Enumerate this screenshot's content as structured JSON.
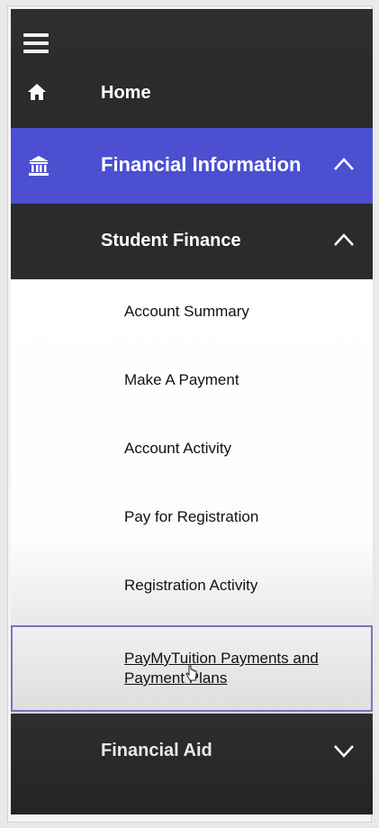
{
  "nav": {
    "home_label": "Home",
    "financial_information_label": "Financial Information",
    "student_finance_label": "Student Finance",
    "student_finance_items": [
      {
        "label": "Account Summary"
      },
      {
        "label": "Make A Payment"
      },
      {
        "label": "Account Activity"
      },
      {
        "label": "Pay for Registration"
      },
      {
        "label": "Registration Activity"
      }
    ],
    "active_item_label": "PayMyTuition Payments and Payment Plans",
    "financial_aid_label": "Financial Aid"
  },
  "colors": {
    "accent": "#4b4fd0",
    "dark": "#2b2b2b",
    "active_border": "#8a6bc0"
  },
  "icons": {
    "menu": "hamburger-menu-icon",
    "home": "home-icon",
    "financial": "bank-icon",
    "expanded": "chevron-up-icon",
    "collapsed": "chevron-down-icon",
    "cursor": "hand-pointer-icon"
  }
}
